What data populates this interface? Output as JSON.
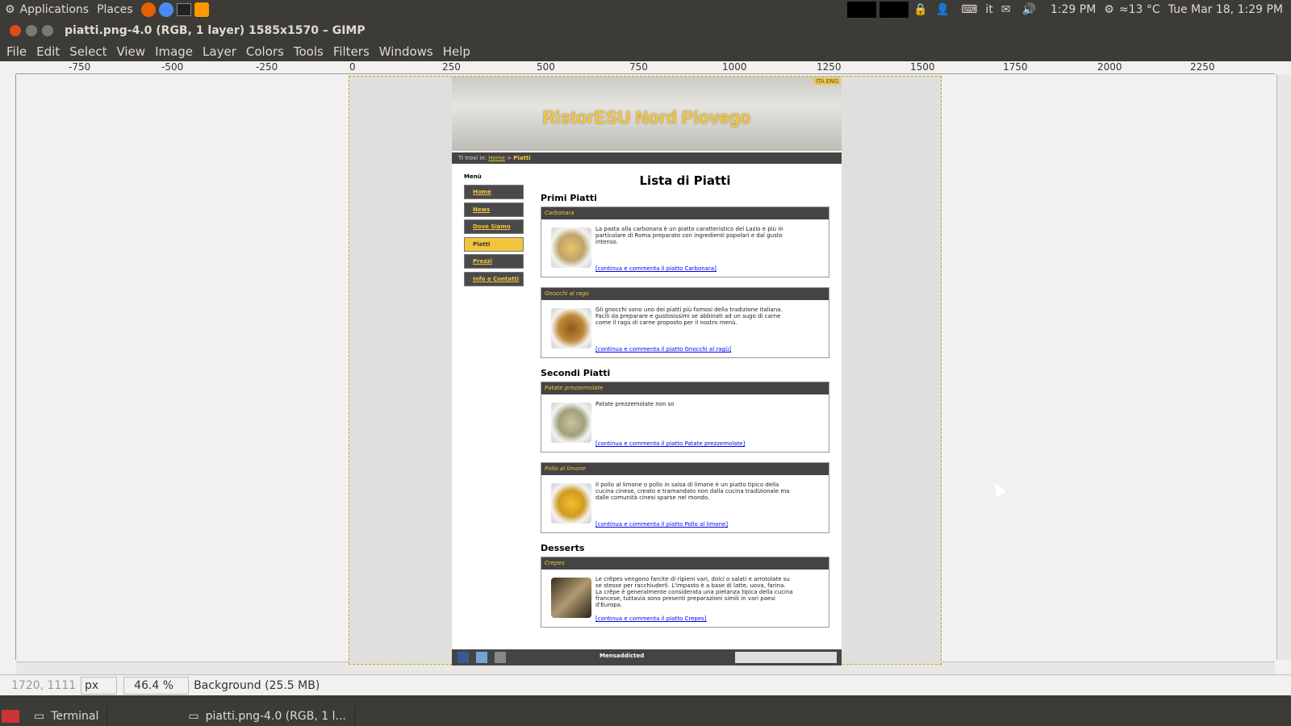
{
  "topbar": {
    "applications": "Applications",
    "places": "Places",
    "lang": "it",
    "time": "1:29 PM",
    "weather": "≈13 °C",
    "datetime": "Tue Mar 18, 1:29 PM"
  },
  "window": {
    "title": "piatti.png-4.0 (RGB, 1 layer) 1585x1570 – GIMP"
  },
  "menu": [
    "File",
    "Edit",
    "Select",
    "View",
    "Image",
    "Layer",
    "Colors",
    "Tools",
    "Filters",
    "Windows",
    "Help"
  ],
  "ruler": {
    "labels": [
      "-750",
      "-500",
      "-250",
      "0",
      "250",
      "500",
      "750",
      "1000",
      "1250",
      "1500",
      "1750",
      "2000",
      "2250"
    ]
  },
  "page": {
    "banner_title": "RistorESU Nord Piovego",
    "lang_links": "ITA ENG",
    "crumb_prefix": "Ti trovi in:",
    "crumb_home": "Home",
    "crumb_sep": ">",
    "crumb_current": "Piatti",
    "menu_title": "Menù",
    "menu_items": [
      "Home",
      "News",
      "Dove Siamo",
      "Piatti",
      "Prezzi",
      "Info e Contatti"
    ],
    "active_menu_index": 3,
    "heading": "Lista di Piatti",
    "sections": [
      {
        "title": "Primi Piatti",
        "dishes": [
          {
            "name": "Carbonara",
            "text": "La pasta alla carbonara è un piatto caratteristico del Lazio e più in particolare di Roma preparato con ingredienti popolari e dal gusto intenso.",
            "link": "[continua e commenta il piatto Carbonara]"
          },
          {
            "name": "Gnocchi al ragù",
            "text": "Gli gnocchi sono uno dei piatti più famosi della tradizione italiana. Facili da preparare e gustosissimi se abbinati ad un sugo di carne come il ragù di carne proposto per il nostro menù.",
            "link": "[continua e commenta il piatto Gnocchi al ragù]"
          }
        ]
      },
      {
        "title": "Secondi Piatti",
        "dishes": [
          {
            "name": "Patate prezzemolate",
            "text": "Patate prezzemolate non so",
            "link": "[continua e commenta il piatto Patate prezzemolate]"
          },
          {
            "name": "Pollo al limone",
            "text": "Il pollo al limone o pollo in salsa di limone è un piatto tipico della cucina cinese, creato e tramandato non dalla cucina tradizionale ma dalle comunità cinesi sparse nel mondo.",
            "link": "[continua e commenta il piatto Pollo al limone]"
          }
        ]
      },
      {
        "title": "Desserts",
        "dishes": [
          {
            "name": "Crepes",
            "text": "Le crêpes vengono farcite di ripieni vari, dolci o salati e arrotolate su se stesse per racchiuderli. L'impasto è a base di latte, uova, farina. La crêpe è generalmente considerata una pietanza tipica della cucina francese, tuttavia sono presenti preparazioni simili in vari paesi d'Europa.",
            "link": "[continua e commenta il piatto Crepes]"
          }
        ]
      }
    ],
    "footer_text": "Mensaddicted"
  },
  "status": {
    "coords": "1720, 1111",
    "unit": "px",
    "zoom": "46.4 %",
    "layer": "Background (25.5 MB)"
  },
  "taskbar": {
    "terminal": "Terminal",
    "gimp": "piatti.png-4.0 (RGB, 1 l..."
  }
}
